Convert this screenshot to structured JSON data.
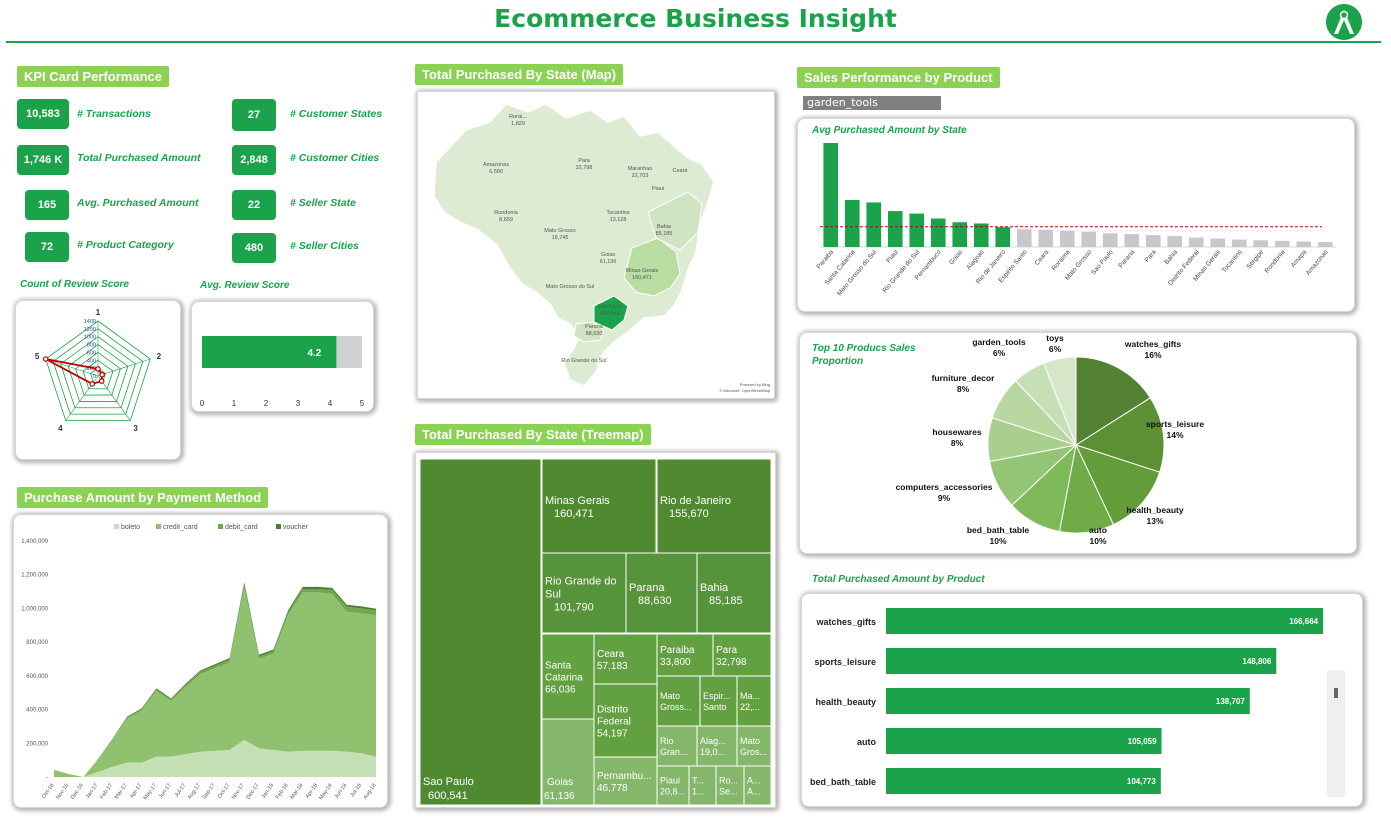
{
  "header": {
    "title": "Ecommerce Business Insight"
  },
  "kpi": {
    "title": "KPI Card Performance",
    "cards": [
      {
        "value": "10,583",
        "label": "# Transactions"
      },
      {
        "value": "1,746 K",
        "label": "Total Purchased Amount"
      },
      {
        "value": "165",
        "label": "Avg. Purchased Amount"
      },
      {
        "value": "72",
        "label": "# Product Category"
      },
      {
        "value": "27",
        "label": "# Customer States"
      },
      {
        "value": "2,848",
        "label": "# Customer Cities"
      },
      {
        "value": "22",
        "label": "# Seller State"
      },
      {
        "value": "480",
        "label": "# Seller Cities"
      }
    ]
  },
  "review_count": {
    "title": "Count of Review Score"
  },
  "review_avg": {
    "title": "Avg. Review Score"
  },
  "payment": {
    "title": "Purchase Amount by Payment Method"
  },
  "map": {
    "title": "Total Purchased By State (Map)",
    "credit": "Powered by Bing\n© Microsoft, OpenStreetMap"
  },
  "treemap_section": {
    "title": "Total Purchased By State (Treemap)"
  },
  "product_section": {
    "title": "Sales Performance by Product",
    "slicer_value": "garden_tools"
  },
  "avg_state": {
    "title": "Avg Purchased Amount by State"
  },
  "top10": {
    "title_line1": "Top 10 Producs Sales",
    "title_line2": "Proportion"
  },
  "product_bars": {
    "title": "Total Purchased Amount by Product"
  },
  "colors": {
    "accent": "#1aa34a",
    "section_bg": "#8bd152",
    "gray": "#c8c8c8",
    "treemap": "#4a8a30"
  },
  "chart_data": [
    {
      "id": "review_radar",
      "type": "radar",
      "categories": [
        "1",
        "2",
        "3",
        "4",
        "5"
      ],
      "ticks": [
        1400,
        1200,
        1000,
        800,
        600,
        400,
        200,
        0
      ],
      "rmax": 1400,
      "values": [
        180,
        110,
        160,
        250,
        1400
      ]
    },
    {
      "id": "avg_review",
      "type": "bar",
      "value": 4.2,
      "value_label": "4.2",
      "xlim": [
        0,
        5
      ],
      "xticks": [
        "0",
        "1",
        "2",
        "3",
        "4",
        "5"
      ]
    },
    {
      "id": "payment_area",
      "type": "area",
      "stacked": true,
      "x": [
        "Oct-16",
        "Nov-16",
        "Dec-16",
        "Jan-17",
        "Feb-17",
        "Mar-17",
        "Apr-17",
        "May-17",
        "Jun-17",
        "Jul-17",
        "Aug-17",
        "Sep-17",
        "Oct-17",
        "Nov-17",
        "Dec-17",
        "Jan-18",
        "Feb-18",
        "Mar-18",
        "Apr-18",
        "May-18",
        "Jun-18",
        "Jul-18",
        "Aug-18"
      ],
      "ylim": [
        0,
        1400000
      ],
      "yticks": [
        "-",
        "200,000",
        "400,000",
        "600,000",
        "800,000",
        "1,000,000",
        "1,200,000",
        "1,400,000"
      ],
      "series": [
        {
          "name": "boleto",
          "color": "#c5e0b4",
          "values": [
            0,
            0,
            0,
            30000,
            60000,
            85000,
            85000,
            120000,
            120000,
            135000,
            150000,
            155000,
            160000,
            220000,
            170000,
            160000,
            150000,
            155000,
            155000,
            155000,
            150000,
            140000,
            120000
          ]
        },
        {
          "name": "credit_card",
          "color": "#8fc16e",
          "values": [
            42000,
            18000,
            0,
            70000,
            160000,
            260000,
            310000,
            390000,
            330000,
            400000,
            460000,
            490000,
            520000,
            900000,
            530000,
            570000,
            810000,
            940000,
            940000,
            930000,
            830000,
            830000,
            840000
          ]
        },
        {
          "name": "debit_card",
          "color": "#6fa84e",
          "values": [
            0,
            0,
            0,
            3000,
            5000,
            8000,
            8000,
            10000,
            10000,
            12000,
            14000,
            15000,
            16000,
            20000,
            15000,
            16000,
            18000,
            20000,
            20000,
            25000,
            30000,
            30000,
            28000
          ]
        },
        {
          "name": "voucher",
          "color": "#4a7f32",
          "values": [
            0,
            0,
            0,
            2000,
            3000,
            5000,
            5000,
            6000,
            6000,
            7000,
            8000,
            9000,
            10000,
            15000,
            10000,
            10000,
            12000,
            13000,
            13000,
            12000,
            12000,
            12000,
            10000
          ]
        }
      ]
    },
    {
      "id": "state_map",
      "type": "map",
      "labels": [
        {
          "name": "Rorai...",
          "value": "1,829"
        },
        {
          "name": "Amazonas",
          "value": "6,580"
        },
        {
          "name": "Para",
          "value": "32,798"
        },
        {
          "name": "Maranhao",
          "value": "22,703"
        },
        {
          "name": "Ceara",
          "value": ""
        },
        {
          "name": "Piaui",
          "value": ""
        },
        {
          "name": "Rondonia",
          "value": "8,659"
        },
        {
          "name": "Tocantins",
          "value": "13,128"
        },
        {
          "name": "Mato Grosso",
          "value": "18,745"
        },
        {
          "name": "Bahia",
          "value": "85,185"
        },
        {
          "name": "Goias",
          "value": "61,136"
        },
        {
          "name": "Minas Gerais",
          "value": "160,471"
        },
        {
          "name": "Mato Grosso do Sul",
          "value": ""
        },
        {
          "name": "Sao Paulo",
          "value": "600,541"
        },
        {
          "name": "Parana",
          "value": "88,630"
        },
        {
          "name": "Rio Grande do Sul",
          "value": ""
        }
      ]
    },
    {
      "id": "state_treemap",
      "type": "treemap",
      "items": [
        {
          "label": "Sao Paulo",
          "value": "600,541"
        },
        {
          "label": "Minas Gerais",
          "value": "160,471"
        },
        {
          "label": "Rio de Janeiro",
          "value": "155,670"
        },
        {
          "label": "Rio Grande do Sul",
          "value": "101,790"
        },
        {
          "label": "Parana",
          "value": "88,630"
        },
        {
          "label": "Bahia",
          "value": "85,185"
        },
        {
          "label": "Santa Catarina",
          "value": "66,036"
        },
        {
          "label": "Ceara",
          "value": "57,183"
        },
        {
          "label": "Paraiba",
          "value": "33,800"
        },
        {
          "label": "Para",
          "value": "32,798"
        },
        {
          "label": "Distrito Federal",
          "value": "54,197"
        },
        {
          "label": "Mato Gross...",
          "value": ""
        },
        {
          "label": "Espir... Santo",
          "value": ""
        },
        {
          "label": "Ma... 22,...",
          "value": ""
        },
        {
          "label": "Goias",
          "value": "61,136"
        },
        {
          "label": "Pernambu...",
          "value": "46,778"
        },
        {
          "label": "Rio Gran...",
          "value": ""
        },
        {
          "label": "Alag... 19,0...",
          "value": ""
        },
        {
          "label": "Mato Gros...",
          "value": ""
        },
        {
          "label": "Piaui",
          "value": "20,8..."
        },
        {
          "label": "T... 1...",
          "value": ""
        },
        {
          "label": "Ro... Se...",
          "value": ""
        },
        {
          "label": "A... A...",
          "value": ""
        }
      ]
    },
    {
      "id": "avg_by_state",
      "type": "bar",
      "categories": [
        "Paraiba",
        "Santa Catarina",
        "Mato Grosso do Sul",
        "Piaui",
        "Rio Grande do Sul",
        "Pernambuco",
        "Goias",
        "Alagoas",
        "Rio de Janeiro",
        "Espirito Santo",
        "Ceara",
        "Roraima",
        "Mato Grosso",
        "Sao Paulo",
        "Parana",
        "Para",
        "Bahia",
        "Distrito Federal",
        "Minas Gerais",
        "Tocantins",
        "Sergipe",
        "Rondonia",
        "Amapa",
        "Amazonas"
      ],
      "values": [
        420,
        190,
        180,
        145,
        135,
        115,
        100,
        95,
        80,
        72,
        70,
        66,
        62,
        55,
        52,
        48,
        44,
        38,
        34,
        30,
        27,
        25,
        22,
        20
      ],
      "highlighted": 9,
      "average": 82
    },
    {
      "id": "top10_pie",
      "type": "pie",
      "slices": [
        {
          "label": "watches_gifts",
          "value": 16,
          "pct": "16%",
          "color": "#548235"
        },
        {
          "label": "sports_leisure",
          "value": 14,
          "pct": "14%",
          "color": "#5b9034"
        },
        {
          "label": "health_beauty",
          "value": 13,
          "pct": "13%",
          "color": "#639d3a"
        },
        {
          "label": "auto",
          "value": 10,
          "pct": "10%",
          "color": "#6fab46"
        },
        {
          "label": "bed_bath_table",
          "value": 10,
          "pct": "10%",
          "color": "#7eb95a"
        },
        {
          "label": "computers_accessories",
          "value": 9,
          "pct": "9%",
          "color": "#94c576"
        },
        {
          "label": "housewares",
          "value": 8,
          "pct": "8%",
          "color": "#a8cf8d"
        },
        {
          "label": "furniture_decor",
          "value": 8,
          "pct": "8%",
          "color": "#b8d7a1"
        },
        {
          "label": "garden_tools",
          "value": 6,
          "pct": "6%",
          "color": "#c7dfb6"
        },
        {
          "label": "toys",
          "value": 6,
          "pct": "6%",
          "color": "#d6e7c9"
        }
      ]
    },
    {
      "id": "product_bars",
      "type": "bar",
      "orientation": "horizontal",
      "categories": [
        "watches_gifts",
        "sports_leisure",
        "health_beauty",
        "auto",
        "bed_bath_table"
      ],
      "values": [
        166664,
        148806,
        138707,
        105059,
        104773
      ],
      "labels": [
        "166,664",
        "148,806",
        "138,707",
        "105,059",
        "104,773"
      ],
      "xmax": 175000
    }
  ]
}
